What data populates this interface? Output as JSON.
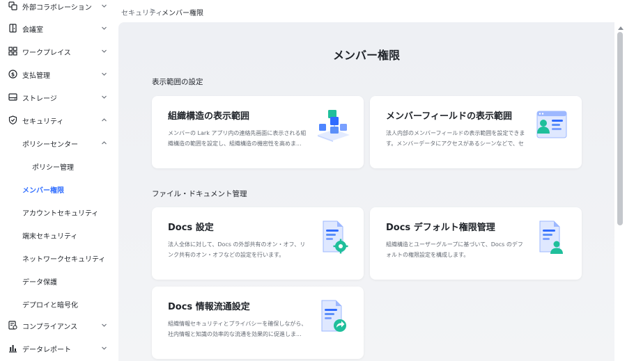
{
  "sidebar": {
    "items": [
      {
        "label": "外部コラボレーション",
        "icon": "collaboration-icon",
        "chevron": "down"
      },
      {
        "label": "会議室",
        "icon": "meeting-room-icon",
        "chevron": "down"
      },
      {
        "label": "ワークプレイス",
        "icon": "workplace-grid-icon",
        "chevron": "down"
      },
      {
        "label": "支払管理",
        "icon": "payment-icon",
        "chevron": "down"
      },
      {
        "label": "ストレージ",
        "icon": "storage-icon",
        "chevron": "down"
      },
      {
        "label": "セキュリティ",
        "icon": "shield-icon",
        "chevron": "up"
      },
      {
        "label": "ポリシーセンター",
        "chevron": "up"
      },
      {
        "label": "ポリシー管理"
      },
      {
        "label": "メンバー権限",
        "active": true
      },
      {
        "label": "アカウントセキュリティ"
      },
      {
        "label": "端末セキュリティ"
      },
      {
        "label": "ネットワークセキュリティ"
      },
      {
        "label": "データ保護"
      },
      {
        "label": "デプロイと暗号化"
      },
      {
        "label": "コンプライアンス",
        "icon": "compliance-icon",
        "chevron": "down"
      },
      {
        "label": "データレポート",
        "icon": "report-chart-icon",
        "chevron": "down"
      }
    ]
  },
  "breadcrumb": {
    "parent": "セキュリティ",
    "separator": ">",
    "current": "メンバー権限"
  },
  "main": {
    "title": "メンバー権限",
    "sections": [
      {
        "title": "表示範囲の設定",
        "cards": [
          {
            "title": "組織構造の表示範囲",
            "desc": "メンバーの Lark アプリ内の連絡先画面に表示される組織構造の範囲を設定し、組織構造の機密性を高めま...",
            "icon": "org-structure-icon"
          },
          {
            "title": "メンバーフィールドの表示範囲",
            "desc": "法人内部のメンバーフィールドの表示範囲を設定できます。メンバーデータにアクセスがあるシーンなどで、センシ...",
            "icon": "member-field-icon"
          }
        ]
      },
      {
        "title": "ファイル・ドキュメント管理",
        "cards": [
          {
            "title": "Docs 設定",
            "desc": "法人全体に対して、Docs の外部共有のオン・オフ、リンク共有のオン・オフなどの設定を行います。",
            "icon": "docs-settings-icon"
          },
          {
            "title": "Docs デフォルト権限管理",
            "desc": "組織構造とユーザーグループに基づいて、Docs のデフォルトの権限設定を構成します。",
            "icon": "docs-permission-icon"
          },
          {
            "title": "Docs 情報流通設定",
            "desc": "組織情報セキュリティとプライバシーを確保しながら、社内情報と知識の効率的な流通を効果的に促進しま...",
            "icon": "docs-share-icon"
          }
        ]
      }
    ]
  },
  "colors": {
    "accent": "#3370ff",
    "text": "#1f2329",
    "muted": "#646a73",
    "background": "#eef0f4",
    "icon_blue": "#5b8ff9",
    "icon_teal": "#1fbf9b"
  }
}
